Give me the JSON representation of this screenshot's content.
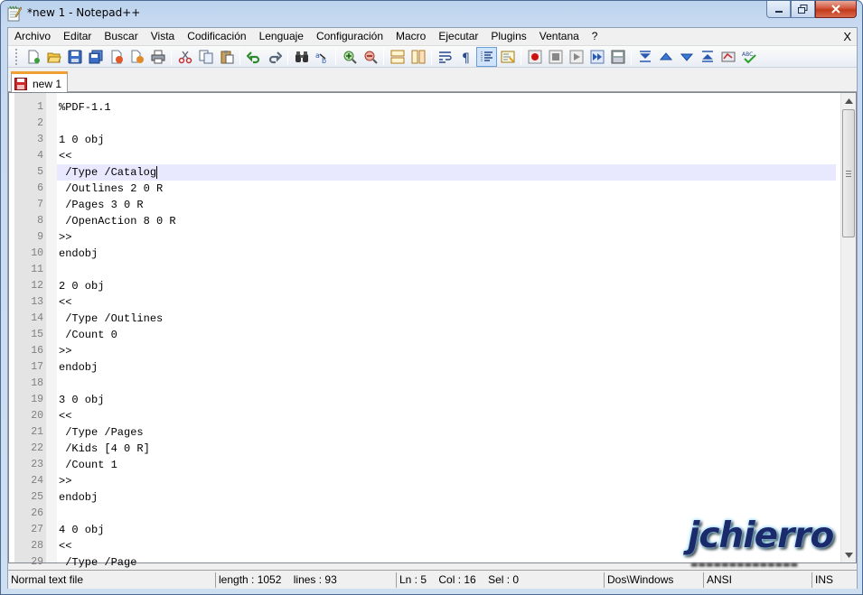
{
  "window": {
    "title": "*new  1 - Notepad++",
    "icon": "notepad-icon",
    "controls": [
      "minimize",
      "maximize",
      "close"
    ]
  },
  "menubar": {
    "items": [
      "Archivo",
      "Editar",
      "Buscar",
      "Vista",
      "Codificación",
      "Lenguaje",
      "Configuración",
      "Macro",
      "Ejecutar",
      "Plugins",
      "Ventana",
      "?"
    ],
    "close_doc": "X"
  },
  "toolbar": {
    "buttons": [
      "new-file",
      "open-file",
      "save",
      "save-all",
      "close",
      "close-all",
      "print",
      "cut",
      "copy",
      "paste",
      "undo",
      "redo",
      "find",
      "replace",
      "zoom-in",
      "zoom-out",
      "sync-vertical",
      "sync-horizontal",
      "word-wrap",
      "show-all-chars",
      "indent-guide",
      "doc-map",
      "record-macro",
      "stop-record",
      "play-macro",
      "run-macro-multiple",
      "save-macro",
      "fold-all",
      "prev-bookmark",
      "next-bookmark",
      "unfold-all",
      "clear-marks",
      "spell-check"
    ]
  },
  "tabs": [
    {
      "label": "new  1",
      "icon": "unsaved-floppy-icon",
      "active": true
    }
  ],
  "editor": {
    "current_line": 5,
    "lines": [
      "%PDF-1.1",
      "",
      "1 0 obj",
      "<<",
      " /Type /Catalog",
      " /Outlines 2 0 R",
      " /Pages 3 0 R",
      " /OpenAction 8 0 R",
      ">>",
      "endobj",
      "",
      "2 0 obj",
      "<<",
      " /Type /Outlines",
      " /Count 0",
      ">>",
      "endobj",
      "",
      "3 0 obj",
      "<<",
      " /Type /Pages",
      " /Kids [4 0 R]",
      " /Count 1",
      ">>",
      "endobj",
      "",
      "4 0 obj",
      "<<",
      " /Type /Page"
    ]
  },
  "statusbar": {
    "file_type": "Normal text file",
    "length": "length : 1052",
    "lines": "lines : 93",
    "ln": "Ln : 5",
    "col": "Col : 16",
    "sel": "Sel : 0",
    "eol": "Dos\\Windows",
    "encoding": "ANSI",
    "mode": "INS"
  },
  "watermark": {
    "text": "jchierro"
  }
}
